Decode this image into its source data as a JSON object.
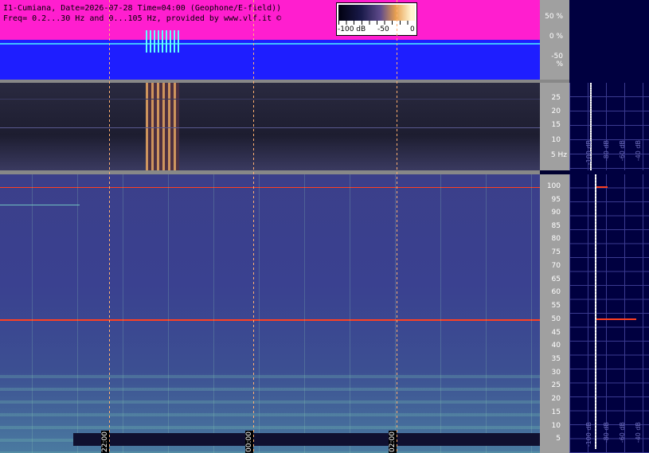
{
  "header": {
    "line1": "I1-Cumiana, Date=2026-07-28 Time=04:00 (Geophone/E-field))",
    "line2": "Freq= 0.2...30 Hz and 0...105 Hz, provided by www.vlf.it ©"
  },
  "colorbar": {
    "min_label": "-100 dB",
    "mid_label": "-50",
    "max_label": "0"
  },
  "amplitude_axis": {
    "ticks": [
      "50 %",
      "0 %",
      "-50 %"
    ]
  },
  "low_freq_axis": {
    "ticks": [
      "25",
      "20",
      "15",
      "10",
      "5 Hz"
    ],
    "right_db_labels": [
      "-100 dB",
      "-80 dB",
      "-60 dB",
      "-40 dB",
      "-20 dB"
    ]
  },
  "high_freq_axis": {
    "ticks": [
      "100",
      "95",
      "90",
      "85",
      "80",
      "75",
      "70",
      "65",
      "60",
      "55",
      "50",
      "45",
      "40",
      "35",
      "30",
      "25",
      "20",
      "15",
      "10",
      "5"
    ],
    "right_db_labels": [
      "-100 dB",
      "-80 dB",
      "-60 dB",
      "-40 dB",
      "-20 dB"
    ]
  },
  "time_markers": [
    "22:00",
    "00:00",
    "02:00"
  ],
  "colors": {
    "amplitude_bg": "#1e1eff",
    "amplitude_fill": "#ff1ecf",
    "line_50hz": "#ff4020",
    "marker": "#ffb070"
  }
}
